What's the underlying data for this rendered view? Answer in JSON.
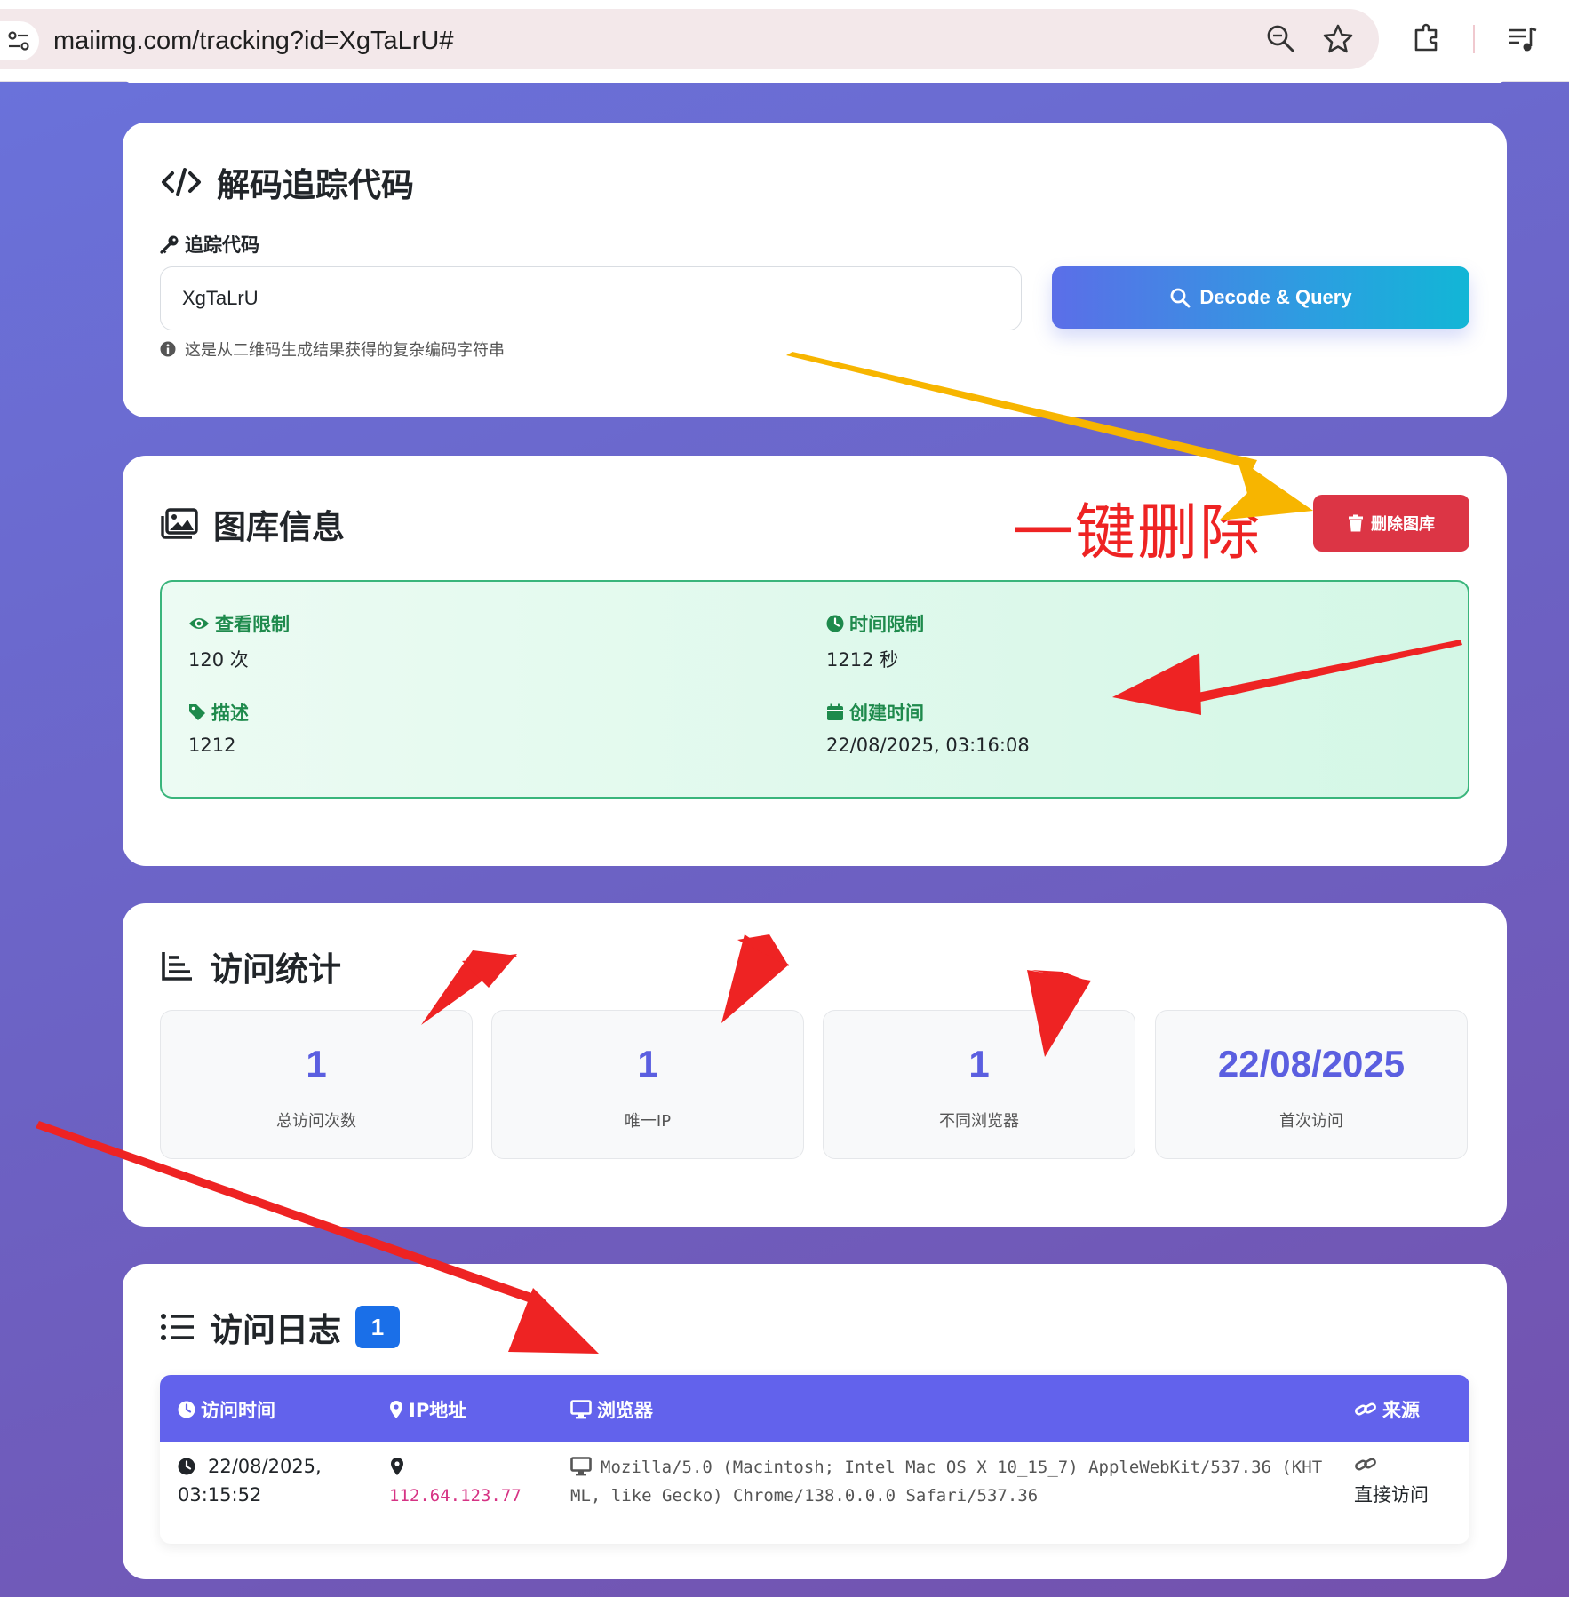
{
  "browser": {
    "url": "maiimg.com/tracking?id=XgTaLrU#"
  },
  "decode_card": {
    "title": "解码追踪代码",
    "field_label": "追踪代码",
    "input_value": "XgTaLrU",
    "button_label": "Decode & Query",
    "hint": "这是从二维码生成结果获得的复杂编码字符串"
  },
  "gallery_card": {
    "title": "图库信息",
    "delete_label": "删除图库",
    "annotation": "一键删除",
    "fields": {
      "view_limit_label": "查看限制",
      "view_limit_value": "120 次",
      "time_limit_label": "时间限制",
      "time_limit_value": "1212 秒",
      "desc_label": "描述",
      "desc_value": "1212",
      "created_label": "创建时间",
      "created_value": "22/08/2025, 03:16:08"
    }
  },
  "stats_card": {
    "title": "访问统计",
    "stats": [
      {
        "value": "1",
        "label": "总访问次数"
      },
      {
        "value": "1",
        "label": "唯一IP"
      },
      {
        "value": "1",
        "label": "不同浏览器"
      },
      {
        "value": "22/08/2025",
        "label": "首次访问"
      }
    ]
  },
  "log_card": {
    "title": "访问日志",
    "count": "1",
    "headers": {
      "time": "访问时间",
      "ip": "IP地址",
      "browser": "浏览器",
      "source": "来源"
    },
    "rows": [
      {
        "time_line1": "22/08/2025,",
        "time_line2": "03:15:52",
        "ip": "112.64.123.77",
        "ua_line1": "Mozilla/5.0 (Macintosh; Intel Mac OS X 10_15_7) AppleWebKit/537.36 (KHT",
        "ua_line2": "ML, like Gecko) Chrome/138.0.0.0 Safari/537.36",
        "source": "直接访问"
      }
    ]
  },
  "colors": {
    "accent": "#5b5fe0",
    "danger": "#dc3545",
    "success": "#1e8a4c",
    "table_header": "#6262ec",
    "annotation_red": "#ee2323",
    "annotation_yellow": "#f7b500"
  }
}
